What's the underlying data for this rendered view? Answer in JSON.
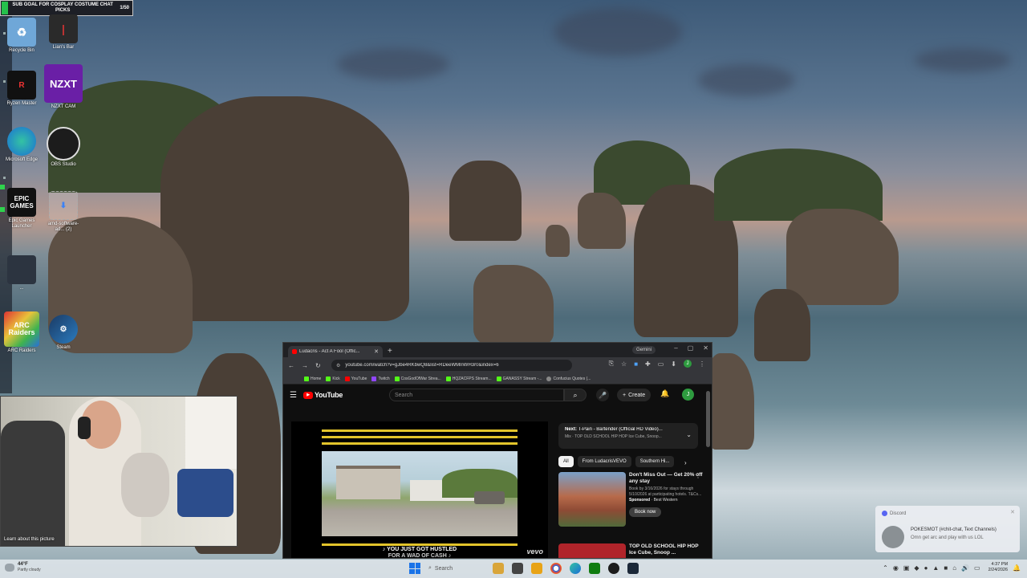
{
  "overlay": {
    "sub_goal_text": "SUB GOAL FOR COSPLAY COSTUME CHAT PICKS",
    "sub_goal_count": "1/50"
  },
  "desktop_icons": [
    {
      "label": "Recycle Bin",
      "icon": "recycle-bin-icon"
    },
    {
      "label": "Lian's Bar",
      "icon": "app-icon"
    },
    {
      "label": "Ryzen Master",
      "icon": "ryzen-master-icon"
    },
    {
      "label": "NZXT CAM",
      "icon_text": "NZXT",
      "icon": "nzxt-cam-icon"
    },
    {
      "label": "Microsoft Edge",
      "icon": "edge-icon"
    },
    {
      "label": "OBS Studio",
      "icon": "obs-icon"
    },
    {
      "label": "Epic Games Launcher",
      "icon_text": "EPIC GAMES",
      "icon": "epic-games-icon"
    },
    {
      "label": "amd-software-ad... (2)",
      "icon": "installer-icon"
    },
    {
      "label": "...",
      "icon": "app-icon"
    },
    {
      "label": "ARC Raiders",
      "icon_text": "ARC Raiders",
      "icon": "arc-raiders-icon"
    },
    {
      "label": "Steam",
      "icon": "steam-icon"
    }
  ],
  "webcam": {
    "learn_text": "Learn about this picture"
  },
  "browser": {
    "tab_title": "Ludacris - Act A Fool (Offic...",
    "gemini_label": "Gemini",
    "url": "youtube.com/watch?v=gJbe4RKbwQ8&list=RDeeWMlnWH3r0&index=6",
    "bookmarks": [
      {
        "label": "Home",
        "color": "#53fc18"
      },
      {
        "label": "Kick",
        "color": "#53fc18"
      },
      {
        "label": "YouTube",
        "color": "#ff0000"
      },
      {
        "label": "Twitch",
        "color": "#9146ff"
      },
      {
        "label": "CosGodOfWar Strea...",
        "color": "#53fc18"
      },
      {
        "label": "HQZACFPS Stream...",
        "color": "#53fc18"
      },
      {
        "label": "GANASSY Stream -...",
        "color": "#53fc18"
      },
      {
        "label": "Confucius Quotes (...",
        "color": "#888888"
      }
    ],
    "youtube": {
      "logo_text": "YouTube",
      "search_placeholder": "Search",
      "create_label": "Create",
      "avatar_letter": "J",
      "next_label": "Next:",
      "next_title": "T-Pain - Bartender (Official HD Video)...",
      "next_sub": "Mix · TOP OLD SCHOOL HIP HOP Ice Cube, Snoop...",
      "chips": [
        "All",
        "From LudacrisVEVO",
        "Southern Hi..."
      ],
      "caption_line1": "♪ YOU JUST GOT HUSTLED",
      "caption_line2": "FOR A WAD OF CASH ♪",
      "vevo": "vevo",
      "recs": [
        {
          "title": "Don't Miss Out — Get 20% off any stay",
          "desc": "Book by 3/16/2026 for stays through 5/10/2026 at participating hotels. T&Cs...",
          "sponsored": "Sponsored",
          "advertiser": "Best Western",
          "button": "Book now"
        },
        {
          "title": "TOP OLD SCHOOL HIP HOP Ice Cube, Snoop ..."
        }
      ]
    }
  },
  "toast": {
    "app": "Discord",
    "line1": "POKESMOT (#chit-chat, Text Channels)",
    "line2": "Omn get arc and play with us LOL"
  },
  "taskbar": {
    "temp": "44°F",
    "condition": "Partly cloudy",
    "search": "Search",
    "time": "4:37 PM",
    "date": "2/24/2026"
  }
}
